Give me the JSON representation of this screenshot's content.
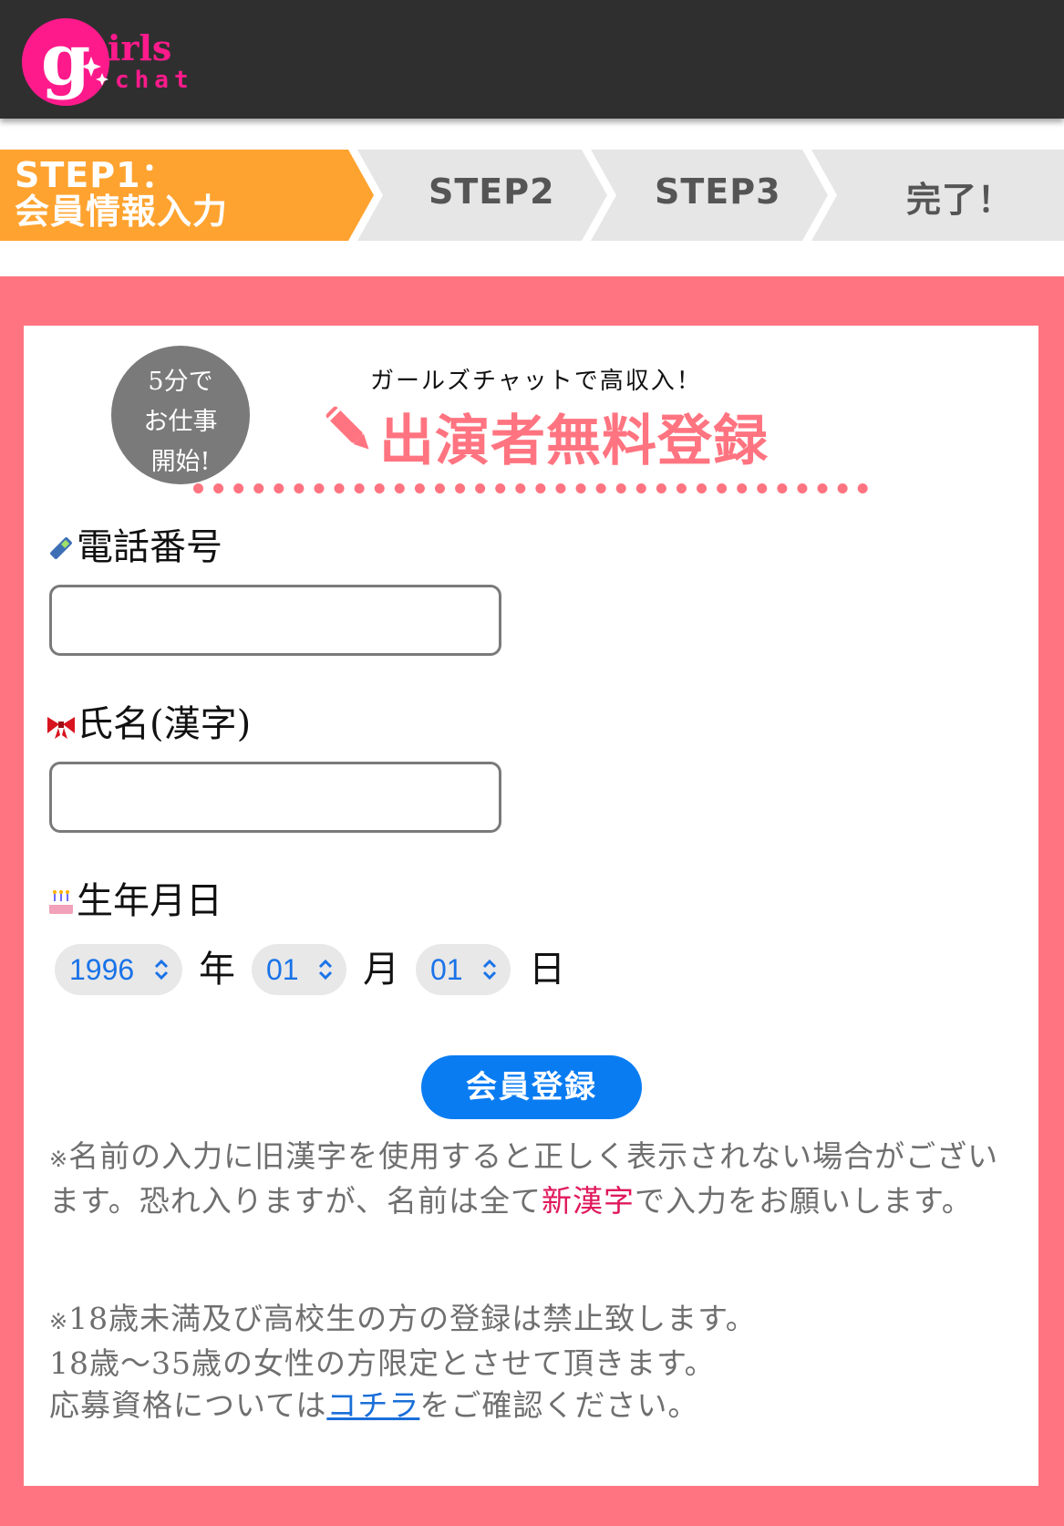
{
  "header": {
    "logo_letter": "g",
    "logo_text_top": "irls",
    "logo_text_bottom": "chat"
  },
  "steps": [
    {
      "label_line1": "STEP1：",
      "label_line2": "会員情報入力",
      "active": true
    },
    {
      "label": "STEP2",
      "active": false
    },
    {
      "label": "STEP3",
      "active": false
    },
    {
      "label": "完了！",
      "active": false
    }
  ],
  "hero": {
    "badge_lines": [
      "5分で",
      "お仕事",
      "開始!"
    ],
    "tagline": "ガールズチャットで高収入！",
    "title": "出演者無料登録"
  },
  "form": {
    "phone": {
      "label": "電話番号",
      "value": "",
      "icon": "mobile-phone-icon"
    },
    "name": {
      "label": "氏名(漢字)",
      "value": "",
      "icon": "ribbon-icon"
    },
    "birthday": {
      "label": "生年月日",
      "icon": "birthday-cake-icon",
      "year": "1996",
      "year_unit": "年",
      "month": "01",
      "month_unit": "月",
      "day": "01",
      "day_unit": "日"
    },
    "submit_label": "会員登録"
  },
  "notes": {
    "note1_mark": "※",
    "note1_before": "名前の入力に旧漢字を使用すると正しく表示されない場合がございます。恐れ入りますが、名前は全て",
    "note1_highlight": "新漢字",
    "note1_after": "で入力をお願いします。",
    "note2_mark": "※",
    "note2_line1": "18歳未満及び高校生の方の登録は禁止致します。",
    "note2_line2": "18歳〜35歳の女性の方限定とさせて頂きます。",
    "note2_line3_before": "応募資格については",
    "note2_link": "コチラ",
    "note2_line3_after": "をご確認ください。"
  },
  "colors": {
    "header_bg": "#2f2f2f",
    "step_active": "#ffa330",
    "step_inactive": "#e6e6e6",
    "frame_pink": "#ff7480",
    "title_pink": "#ff7480",
    "button_blue": "#0a7cf2",
    "highlight_pink": "#e0195c",
    "link_blue": "#1a6fd8"
  }
}
